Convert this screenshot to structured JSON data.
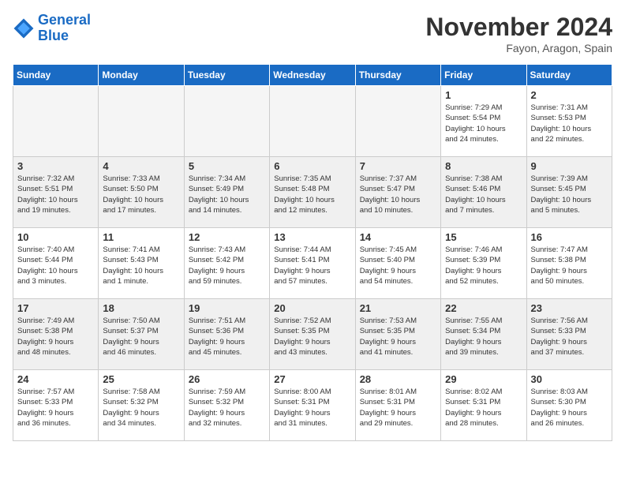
{
  "header": {
    "logo_line1": "General",
    "logo_line2": "Blue",
    "month": "November 2024",
    "location": "Fayon, Aragon, Spain"
  },
  "weekdays": [
    "Sunday",
    "Monday",
    "Tuesday",
    "Wednesday",
    "Thursday",
    "Friday",
    "Saturday"
  ],
  "weeks": [
    {
      "days": [
        {
          "num": "",
          "info": ""
        },
        {
          "num": "",
          "info": ""
        },
        {
          "num": "",
          "info": ""
        },
        {
          "num": "",
          "info": ""
        },
        {
          "num": "",
          "info": ""
        },
        {
          "num": "1",
          "info": "Sunrise: 7:29 AM\nSunset: 5:54 PM\nDaylight: 10 hours\nand 24 minutes."
        },
        {
          "num": "2",
          "info": "Sunrise: 7:31 AM\nSunset: 5:53 PM\nDaylight: 10 hours\nand 22 minutes."
        }
      ]
    },
    {
      "days": [
        {
          "num": "3",
          "info": "Sunrise: 7:32 AM\nSunset: 5:51 PM\nDaylight: 10 hours\nand 19 minutes."
        },
        {
          "num": "4",
          "info": "Sunrise: 7:33 AM\nSunset: 5:50 PM\nDaylight: 10 hours\nand 17 minutes."
        },
        {
          "num": "5",
          "info": "Sunrise: 7:34 AM\nSunset: 5:49 PM\nDaylight: 10 hours\nand 14 minutes."
        },
        {
          "num": "6",
          "info": "Sunrise: 7:35 AM\nSunset: 5:48 PM\nDaylight: 10 hours\nand 12 minutes."
        },
        {
          "num": "7",
          "info": "Sunrise: 7:37 AM\nSunset: 5:47 PM\nDaylight: 10 hours\nand 10 minutes."
        },
        {
          "num": "8",
          "info": "Sunrise: 7:38 AM\nSunset: 5:46 PM\nDaylight: 10 hours\nand 7 minutes."
        },
        {
          "num": "9",
          "info": "Sunrise: 7:39 AM\nSunset: 5:45 PM\nDaylight: 10 hours\nand 5 minutes."
        }
      ]
    },
    {
      "days": [
        {
          "num": "10",
          "info": "Sunrise: 7:40 AM\nSunset: 5:44 PM\nDaylight: 10 hours\nand 3 minutes."
        },
        {
          "num": "11",
          "info": "Sunrise: 7:41 AM\nSunset: 5:43 PM\nDaylight: 10 hours\nand 1 minute."
        },
        {
          "num": "12",
          "info": "Sunrise: 7:43 AM\nSunset: 5:42 PM\nDaylight: 9 hours\nand 59 minutes."
        },
        {
          "num": "13",
          "info": "Sunrise: 7:44 AM\nSunset: 5:41 PM\nDaylight: 9 hours\nand 57 minutes."
        },
        {
          "num": "14",
          "info": "Sunrise: 7:45 AM\nSunset: 5:40 PM\nDaylight: 9 hours\nand 54 minutes."
        },
        {
          "num": "15",
          "info": "Sunrise: 7:46 AM\nSunset: 5:39 PM\nDaylight: 9 hours\nand 52 minutes."
        },
        {
          "num": "16",
          "info": "Sunrise: 7:47 AM\nSunset: 5:38 PM\nDaylight: 9 hours\nand 50 minutes."
        }
      ]
    },
    {
      "days": [
        {
          "num": "17",
          "info": "Sunrise: 7:49 AM\nSunset: 5:38 PM\nDaylight: 9 hours\nand 48 minutes."
        },
        {
          "num": "18",
          "info": "Sunrise: 7:50 AM\nSunset: 5:37 PM\nDaylight: 9 hours\nand 46 minutes."
        },
        {
          "num": "19",
          "info": "Sunrise: 7:51 AM\nSunset: 5:36 PM\nDaylight: 9 hours\nand 45 minutes."
        },
        {
          "num": "20",
          "info": "Sunrise: 7:52 AM\nSunset: 5:35 PM\nDaylight: 9 hours\nand 43 minutes."
        },
        {
          "num": "21",
          "info": "Sunrise: 7:53 AM\nSunset: 5:35 PM\nDaylight: 9 hours\nand 41 minutes."
        },
        {
          "num": "22",
          "info": "Sunrise: 7:55 AM\nSunset: 5:34 PM\nDaylight: 9 hours\nand 39 minutes."
        },
        {
          "num": "23",
          "info": "Sunrise: 7:56 AM\nSunset: 5:33 PM\nDaylight: 9 hours\nand 37 minutes."
        }
      ]
    },
    {
      "days": [
        {
          "num": "24",
          "info": "Sunrise: 7:57 AM\nSunset: 5:33 PM\nDaylight: 9 hours\nand 36 minutes."
        },
        {
          "num": "25",
          "info": "Sunrise: 7:58 AM\nSunset: 5:32 PM\nDaylight: 9 hours\nand 34 minutes."
        },
        {
          "num": "26",
          "info": "Sunrise: 7:59 AM\nSunset: 5:32 PM\nDaylight: 9 hours\nand 32 minutes."
        },
        {
          "num": "27",
          "info": "Sunrise: 8:00 AM\nSunset: 5:31 PM\nDaylight: 9 hours\nand 31 minutes."
        },
        {
          "num": "28",
          "info": "Sunrise: 8:01 AM\nSunset: 5:31 PM\nDaylight: 9 hours\nand 29 minutes."
        },
        {
          "num": "29",
          "info": "Sunrise: 8:02 AM\nSunset: 5:31 PM\nDaylight: 9 hours\nand 28 minutes."
        },
        {
          "num": "30",
          "info": "Sunrise: 8:03 AM\nSunset: 5:30 PM\nDaylight: 9 hours\nand 26 minutes."
        }
      ]
    }
  ]
}
